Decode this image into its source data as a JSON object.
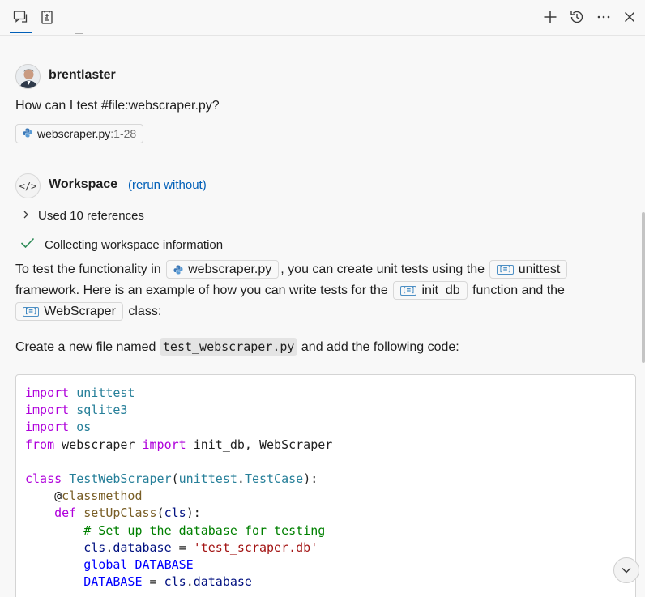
{
  "toolbar": {
    "left_icons": [
      "chat-icon",
      "notes-icon"
    ],
    "right_icons": [
      "plus-icon",
      "history-icon",
      "more-icon",
      "close-icon"
    ]
  },
  "user": {
    "name": "brentlaster",
    "question": "How can I test #file:webscraper.py?",
    "attachment": {
      "name": "webscraper.py",
      "range": ":1-28"
    }
  },
  "response": {
    "agent": "Workspace",
    "rerun_label": "(rerun without)",
    "references_label": "Used 10 references",
    "progress_label": "Collecting workspace information",
    "para1": {
      "t1": "To test the functionality in",
      "chip1": "webscraper.py",
      "t2": ", you can create unit tests using the",
      "chip2": "unittest",
      "t3": "framework. Here is an example of how you can write tests for the",
      "chip3": "init_db",
      "t4": "function and the",
      "chip4": "WebScraper",
      "t5": "class:"
    },
    "para2": {
      "t1": "Create a new file named",
      "code": "test_webscraper.py",
      "t2": "and add the following code:"
    },
    "code_lines": [
      "import unittest",
      "import sqlite3",
      "import os",
      "from webscraper import init_db, WebScraper",
      "",
      "class TestWebScraper(unittest.TestCase):",
      "    @classmethod",
      "    def setUpClass(cls):",
      "        # Set up the database for testing",
      "        cls.database = 'test_scraper.db'",
      "        global DATABASE",
      "        DATABASE = cls.database"
    ]
  },
  "colors": {
    "accent": "#005fb8",
    "success_check": "#2e8b57",
    "keyword": "#af00db",
    "module": "#267f99",
    "comment": "#008000",
    "string": "#a31515"
  }
}
